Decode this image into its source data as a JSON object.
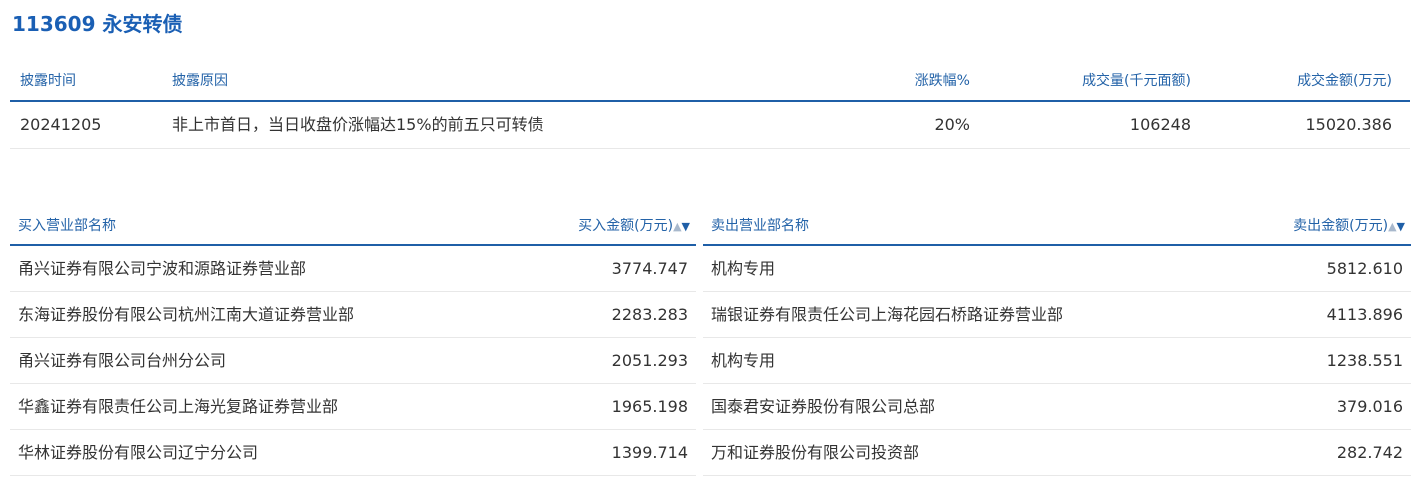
{
  "title": "113609 永安转债",
  "disclosure": {
    "headers": {
      "date": "披露时间",
      "reason": "披露原因",
      "pct": "涨跌幅%",
      "volume": "成交量(千元面额)",
      "amount": "成交金额(万元)"
    },
    "row": {
      "date": "20241205",
      "reason": "非上市首日，当日收盘价涨幅达15%的前五只可转债",
      "pct": "20%",
      "volume": "106248",
      "amount": "15020.386"
    }
  },
  "buy": {
    "header_name": "买入营业部名称",
    "header_amount": "买入金额(万元)",
    "sort_up": "▲",
    "sort_down": "▼",
    "rows": [
      {
        "name": "甬兴证券有限公司宁波和源路证券营业部",
        "amount": "3774.747"
      },
      {
        "name": "东海证券股份有限公司杭州江南大道证券营业部",
        "amount": "2283.283"
      },
      {
        "name": "甬兴证券有限公司台州分公司",
        "amount": "2051.293"
      },
      {
        "name": "华鑫证券有限责任公司上海光复路证券营业部",
        "amount": "1965.198"
      },
      {
        "name": "华林证券股份有限公司辽宁分公司",
        "amount": "1399.714"
      }
    ]
  },
  "sell": {
    "header_name": "卖出营业部名称",
    "header_amount": "卖出金额(万元)",
    "sort_up": "▲",
    "sort_down": "▼",
    "rows": [
      {
        "name": "机构专用",
        "amount": "5812.610"
      },
      {
        "name": "瑞银证券有限责任公司上海花园石桥路证券营业部",
        "amount": "4113.896"
      },
      {
        "name": "机构专用",
        "amount": "1238.551"
      },
      {
        "name": "国泰君安证券股份有限公司总部",
        "amount": "379.016"
      },
      {
        "name": "万和证券股份有限公司投资部",
        "amount": "282.742"
      }
    ]
  }
}
